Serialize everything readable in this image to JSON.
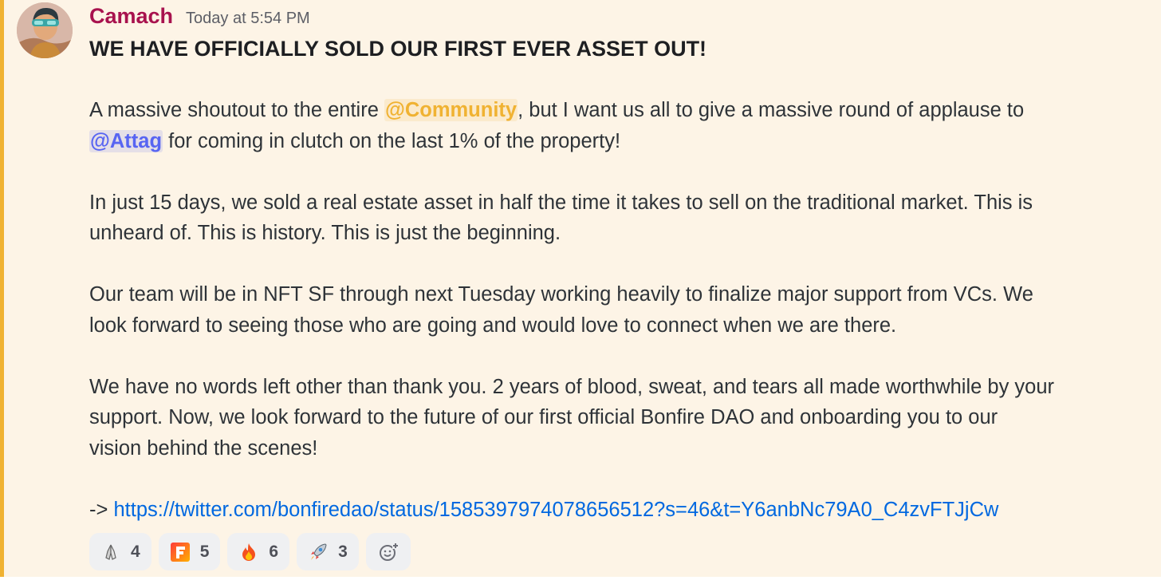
{
  "message": {
    "author": "Camach",
    "timestamp": "Today at 5:54 PM",
    "headline": "WE HAVE OFFICIALLY SOLD OUR FIRST EVER ASSET OUT!",
    "p1": {
      "before": "A massive shoutout to the entire ",
      "mention_role": "@Community",
      "after": ", but I want us all to give a massive round of applause to",
      "mention_user": "@Attag",
      "end": " for coming in clutch on the last 1% of the property!"
    },
    "p2": {
      "line1": "In just 15 days, we sold a real estate asset in half the time it takes to sell on the traditional market. This is",
      "line2": "unheard of. This is history. This is just the beginning."
    },
    "p3": {
      "line1": "Our team will be in NFT SF through next Tuesday working heavily to finalize major support from VCs. We",
      "line2": "look forward to seeing those who are going and would love to connect when we are there."
    },
    "p4": {
      "line1": "We have no words left other than thank you. 2 years of blood, sweat, and tears all made worthwhile by your",
      "line2": "support. Now, we look forward to the future of our first official Bonfire DAO and onboarding you to our",
      "line3": "vision behind the scenes!"
    },
    "link_prefix": "-> ",
    "link": "https://twitter.com/bonfiredao/status/1585397974078656512?s=46&t=Y6anbNc79A0_C4zvFTJjCw"
  },
  "reactions": [
    {
      "emoji": "praying-hands-icon",
      "count": "4"
    },
    {
      "emoji": "f-logo-icon",
      "count": "5"
    },
    {
      "emoji": "fire-icon",
      "count": "6"
    },
    {
      "emoji": "rocket-icon",
      "count": "3"
    }
  ],
  "colors": {
    "background": "#fdf4e6",
    "highlight": "#f0b232",
    "username": "#a8124e",
    "mention_role": "#f0b232",
    "mention_user": "#5865f2",
    "link": "#0068e0"
  }
}
